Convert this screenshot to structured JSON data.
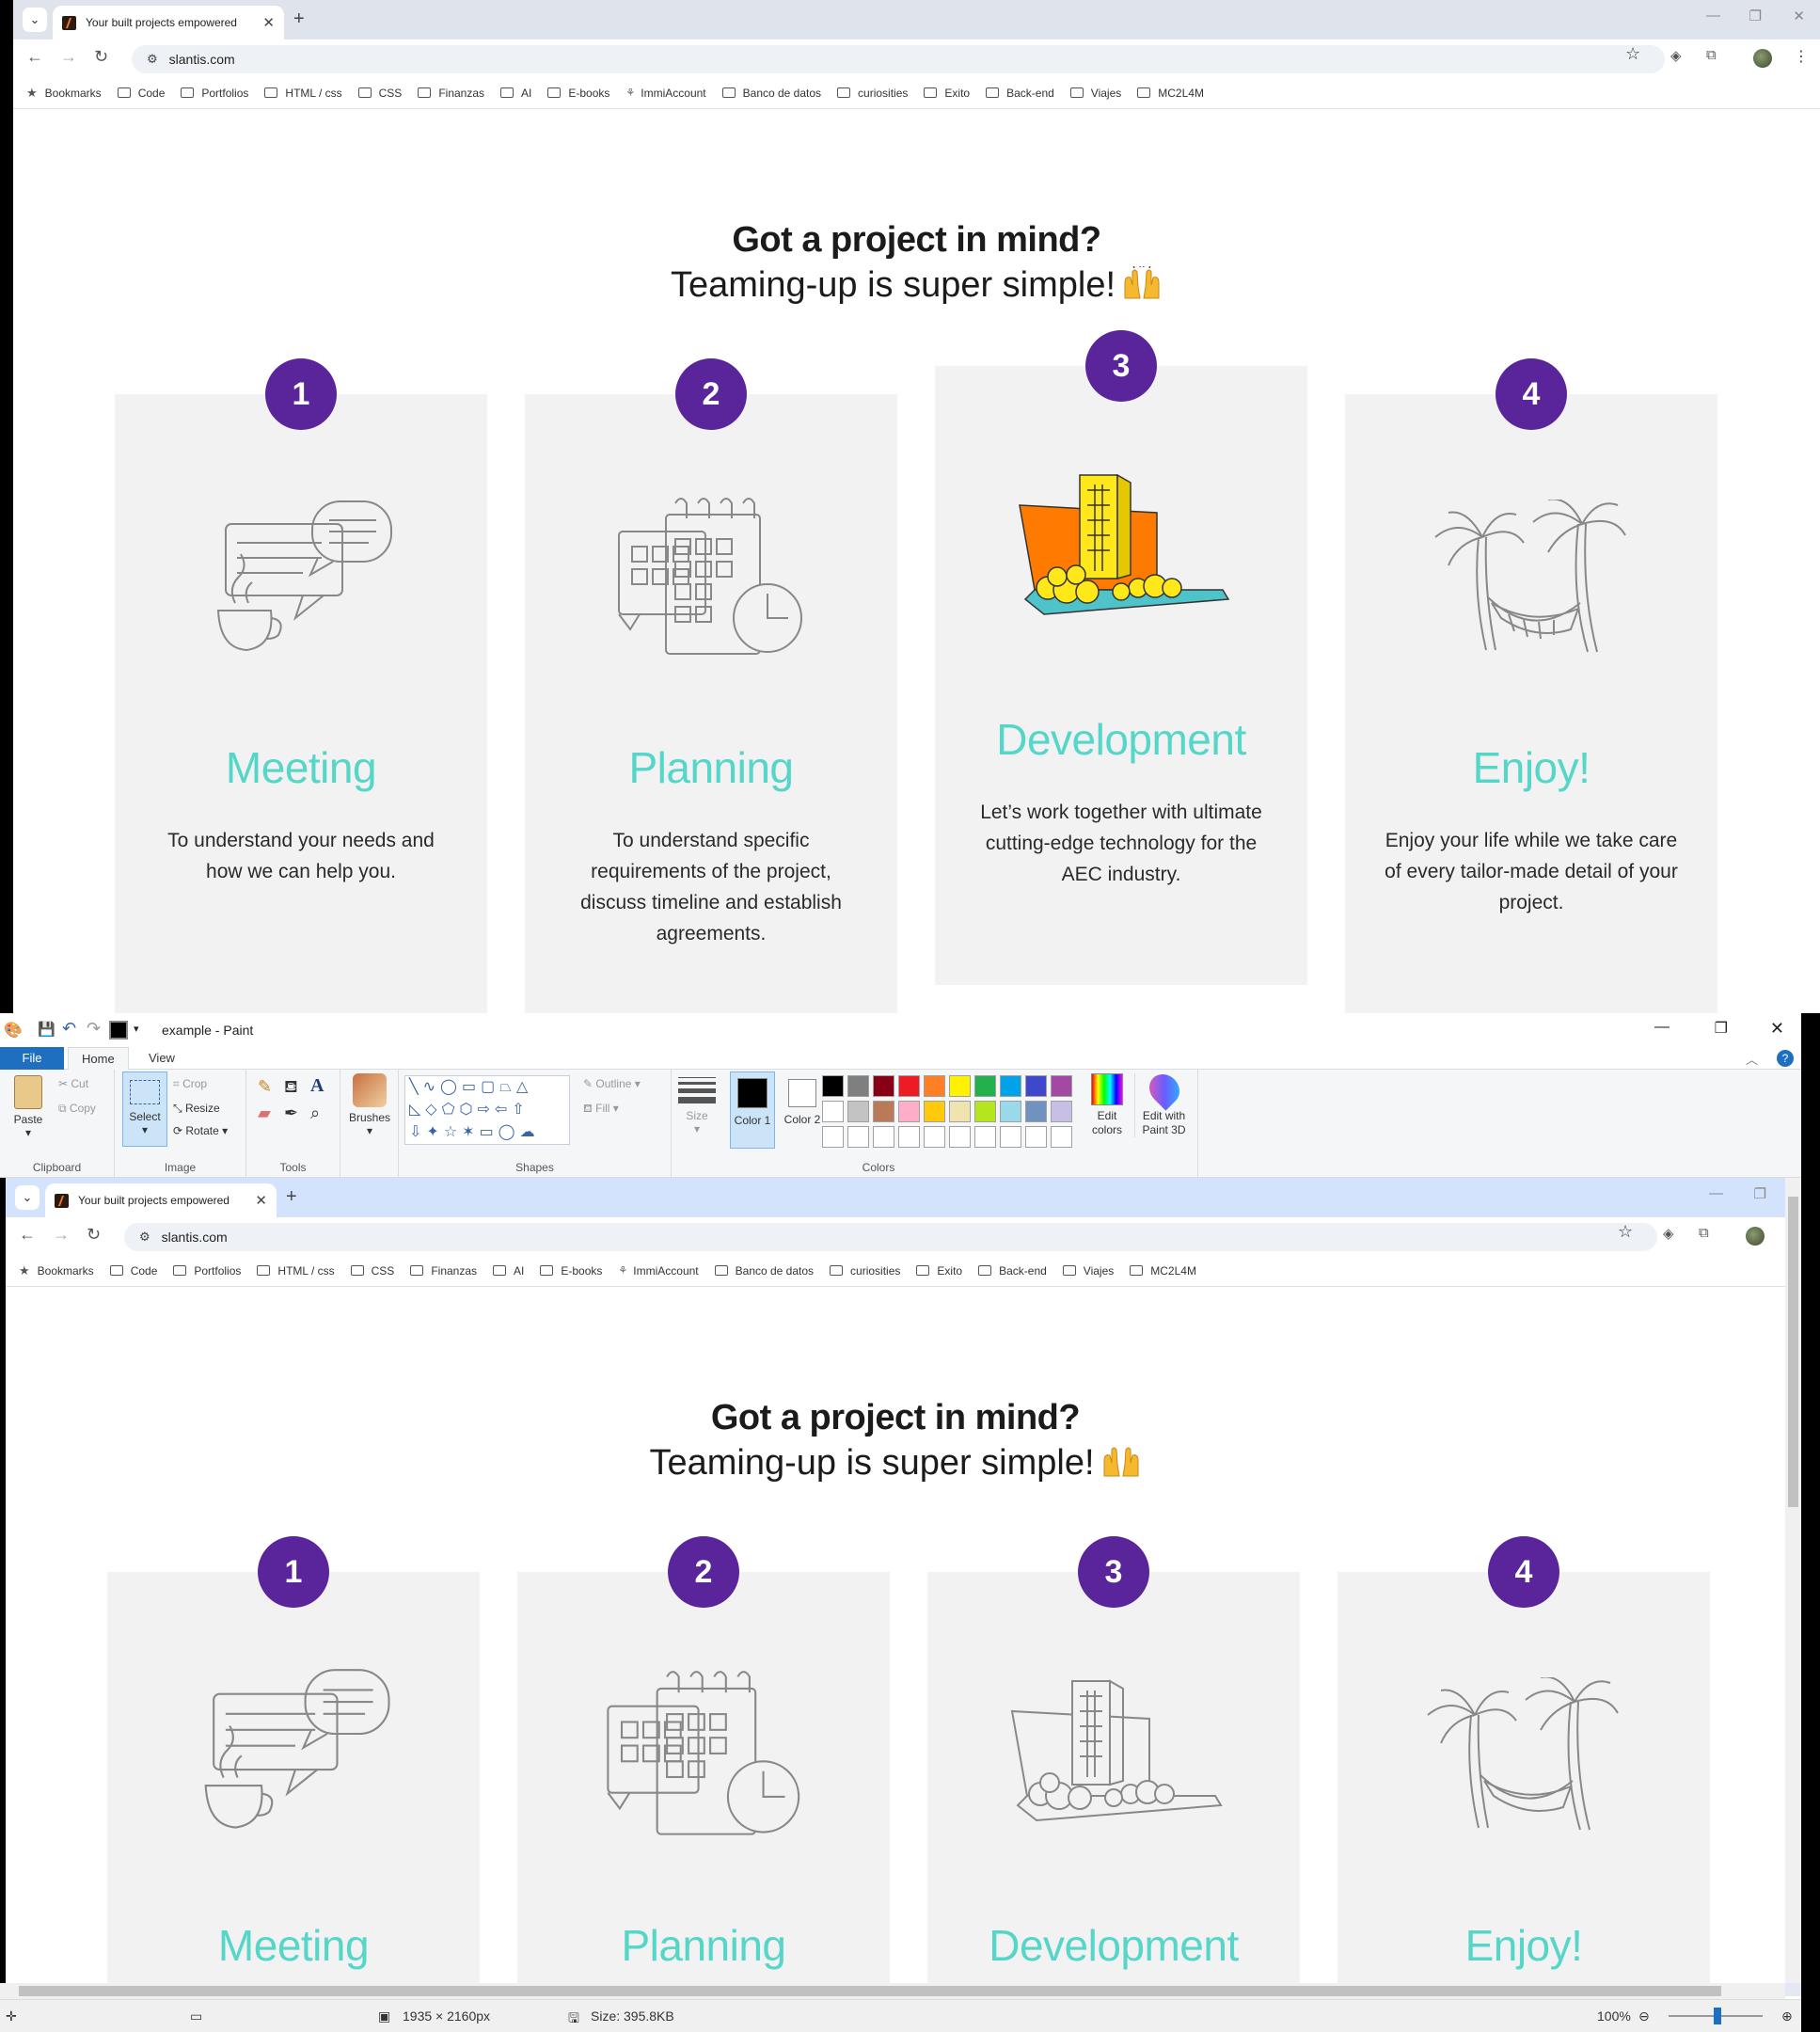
{
  "browser": {
    "tab_title": "Your built projects empowered",
    "tab_close": "✕",
    "new_tab": "+",
    "tab_menu": "⌄",
    "url": "slantis.com",
    "bookmarks_label": "Bookmarks",
    "bookmarks": [
      "Code",
      "Portfolios",
      "HTML / css",
      "CSS",
      "Finanzas",
      "AI",
      "E-books",
      "ImmiAccount",
      "Banco de datos",
      "curiosities",
      "Exito",
      "Back-end",
      "Viajes",
      "MC2L4M"
    ]
  },
  "page": {
    "heading_line1": "Got a project in mind?",
    "heading_line2": "Teaming-up is super simple!",
    "steps": [
      {
        "number": "1",
        "title": "Meeting",
        "text": "To understand your needs and how we can help you."
      },
      {
        "number": "2",
        "title": "Planning",
        "text": "To understand specific requirements of the project, discuss timeline and establish agreements."
      },
      {
        "number": "3",
        "title": "Development",
        "text": "Let’s work together with ultimate cutting-edge technology for the AEC industry."
      },
      {
        "number": "4",
        "title": "Enjoy!",
        "text": "Enjoy your life while we take care of every tailor-made detail of your project."
      }
    ]
  },
  "paint": {
    "window_title": "example - Paint",
    "tabs": {
      "file": "File",
      "home": "Home",
      "view": "View"
    },
    "clipboard": {
      "paste": "Paste",
      "cut": "Cut",
      "copy": "Copy",
      "label": "Clipboard"
    },
    "image": {
      "select": "Select",
      "crop": "Crop",
      "resize": "Resize",
      "rotate": "Rotate",
      "label": "Image"
    },
    "tools_label": "Tools",
    "brushes": "Brushes",
    "shapes": {
      "outline": "Outline",
      "fill": "Fill",
      "label": "Shapes"
    },
    "size": "Size",
    "color1": "Color 1",
    "color2": "Color 2",
    "edit_colors": "Edit colors",
    "edit_paint3d": "Edit with Paint 3D",
    "colors_label": "Colors",
    "palette_row1": [
      "#000000",
      "#7f7f7f",
      "#880015",
      "#ed1c24",
      "#ff7f27",
      "#fff200",
      "#22b14c",
      "#00a2e8",
      "#3f48cc",
      "#a349a4"
    ],
    "palette_row2": [
      "#ffffff",
      "#c3c3c3",
      "#b97a57",
      "#ffaec9",
      "#ffc90e",
      "#efe4b0",
      "#b5e61d",
      "#99d9ea",
      "#7092be",
      "#c8bfe7"
    ],
    "status": {
      "dimensions": "1935 × 2160px",
      "size": "Size: 395.8KB",
      "zoom": "100%"
    }
  }
}
